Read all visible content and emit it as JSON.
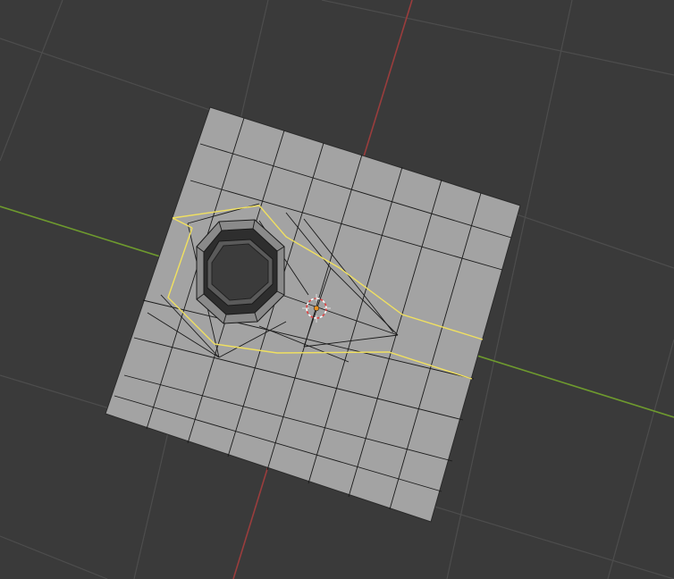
{
  "viewport": {
    "label": "",
    "background_color": "#3a3a3a",
    "grid_color": "#4a4a4a",
    "x_axis_color": "#6e9a2e",
    "y_axis_color": "#9a3d3d",
    "mesh_fill": "#a3a3a3",
    "mesh_edge": "#111111",
    "selection_color": "#f0e060",
    "hole_inner_color": "#2e2e2e",
    "hole_wall_color": "#5a5a5a"
  },
  "objects": {
    "plane_mesh": "plane-with-hole",
    "cursor": "3d-cursor-icon"
  }
}
